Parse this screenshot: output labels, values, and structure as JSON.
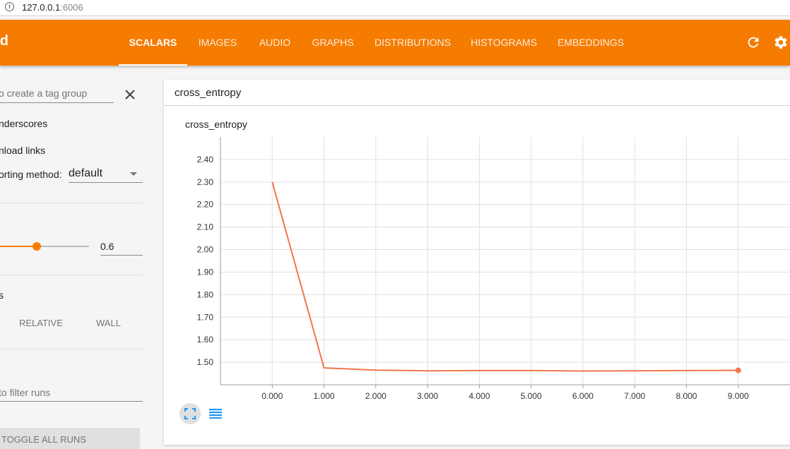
{
  "browser": {
    "url_host": "127.0.0.1",
    "url_port": ":6006"
  },
  "header": {
    "brand": "rd",
    "tabs": [
      {
        "label": "SCALARS",
        "active": true
      },
      {
        "label": "IMAGES"
      },
      {
        "label": "AUDIO"
      },
      {
        "label": "GRAPHS"
      },
      {
        "label": "DISTRIBUTIONS"
      },
      {
        "label": "HISTOGRAMS"
      },
      {
        "label": "EMBEDDINGS"
      }
    ],
    "icons": [
      "refresh-icon",
      "settings-icon"
    ]
  },
  "sidebar": {
    "tag_group_placeholder": "o create a tag group",
    "underscores_label": "nderscores",
    "download_links_label": "nload links",
    "sorting_label": "orting method:",
    "sorting_value": "default",
    "smoothing_value": "0.6",
    "smoothing_fraction": 0.6,
    "horizontal_axis_label": "s",
    "axis_options": [
      "RELATIVE",
      "WALL"
    ],
    "filter_runs_placeholder": "to filter runs",
    "toggle_all_runs": "TOGGLE ALL RUNS"
  },
  "colors": {
    "accent": "#f57c00",
    "series": "#f4754a",
    "blue": "#2196f3"
  },
  "main": {
    "card_header_title": "cross_entropy",
    "chart_title": "cross_entropy",
    "icons": [
      "fit-domain-icon",
      "log-scale-icon"
    ]
  },
  "chart_data": {
    "type": "line",
    "title": "cross_entropy",
    "x": [
      0,
      1,
      2,
      3,
      4,
      5,
      6,
      7,
      8,
      9
    ],
    "series": [
      {
        "values": [
          2.3,
          1.475,
          1.465,
          1.462,
          1.463,
          1.463,
          1.461,
          1.462,
          1.463,
          1.464
        ]
      }
    ],
    "x_ticks": [
      "0.000",
      "1.000",
      "2.000",
      "3.000",
      "4.000",
      "5.000",
      "6.000",
      "7.000",
      "8.000",
      "9.000"
    ],
    "y_ticks": [
      "1.50",
      "1.60",
      "1.70",
      "1.80",
      "1.90",
      "2.00",
      "2.10",
      "2.20",
      "2.30",
      "2.40"
    ],
    "xlim": [
      -1,
      10
    ],
    "ylim": [
      1.4,
      2.5
    ],
    "grid": true
  }
}
